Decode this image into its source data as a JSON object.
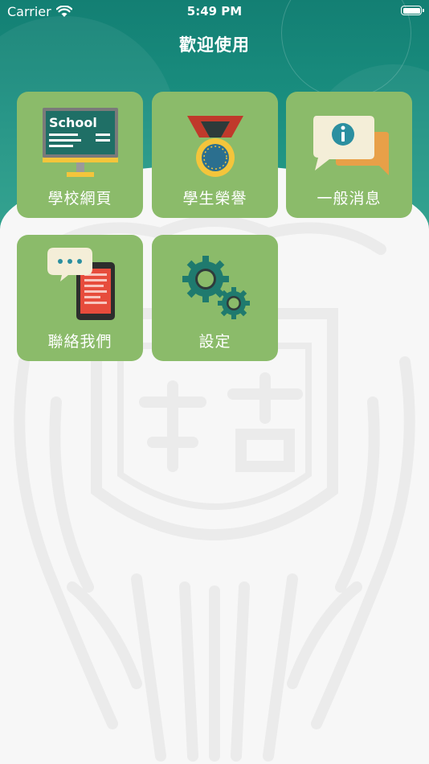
{
  "status_bar": {
    "carrier": "Carrier",
    "time": "5:49 PM"
  },
  "header": {
    "title": "歡迎使用"
  },
  "menu": [
    {
      "label": "學校網頁",
      "icon": "school-board-icon",
      "board_text": "School"
    },
    {
      "label": "學生榮譽",
      "icon": "medal-icon"
    },
    {
      "label": "一般消息",
      "icon": "info-message-icon"
    },
    {
      "label": "聯絡我們",
      "icon": "phone-chat-icon"
    },
    {
      "label": "設定",
      "icon": "gears-icon"
    }
  ],
  "colors": {
    "header": "#137f73",
    "tile": "#8bbb6a",
    "background": "#f7f7f7"
  }
}
